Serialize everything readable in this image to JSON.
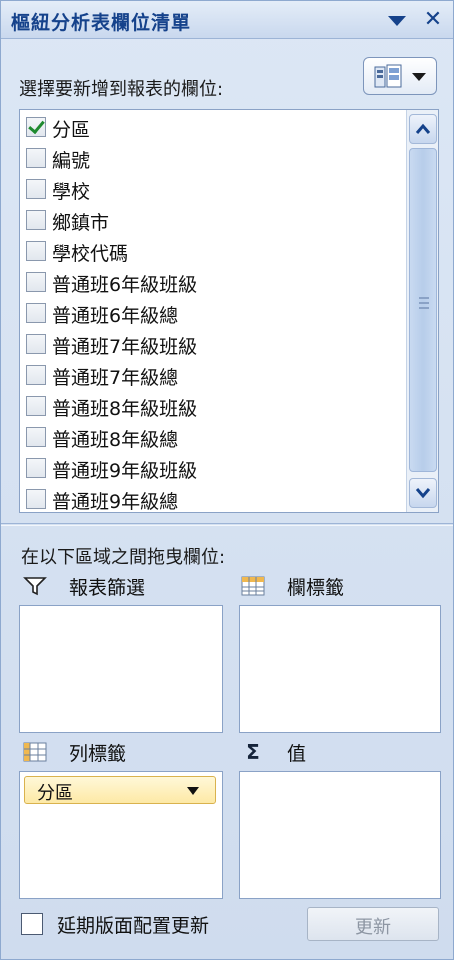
{
  "window": {
    "title": "樞紐分析表欄位清單"
  },
  "field_section": {
    "label": "選擇要新增到報表的欄位:"
  },
  "fields": [
    {
      "label": "分區",
      "checked": true
    },
    {
      "label": "編號",
      "checked": false
    },
    {
      "label": "學校",
      "checked": false
    },
    {
      "label": "鄉鎮市",
      "checked": false
    },
    {
      "label": "學校代碼",
      "checked": false
    },
    {
      "label": "普通班6年級班級",
      "checked": false
    },
    {
      "label": "普通班6年級總",
      "checked": false
    },
    {
      "label": "普通班7年級班級",
      "checked": false
    },
    {
      "label": "普通班7年級總",
      "checked": false
    },
    {
      "label": "普通班8年級班級",
      "checked": false
    },
    {
      "label": "普通班8年級總",
      "checked": false
    },
    {
      "label": "普通班9年級班級",
      "checked": false
    },
    {
      "label": "普通班9年級總",
      "checked": false
    }
  ],
  "areas_section": {
    "label": "在以下區域之間拖曳欄位:"
  },
  "areas": {
    "report_filter": {
      "label": "報表篩選",
      "icon": "filter-icon"
    },
    "column_labels": {
      "label": "欄標籤",
      "icon": "column-grid-icon"
    },
    "row_labels": {
      "label": "列標籤",
      "icon": "row-grid-icon",
      "chip": "分區"
    },
    "values": {
      "label": "值",
      "icon": "sigma-icon"
    }
  },
  "footer": {
    "defer_label": "延期版面配置更新",
    "update_label": "更新"
  },
  "colors": {
    "title": "#15428b",
    "check": "#1f8a2f",
    "chip_bg": "#fde9a6"
  }
}
